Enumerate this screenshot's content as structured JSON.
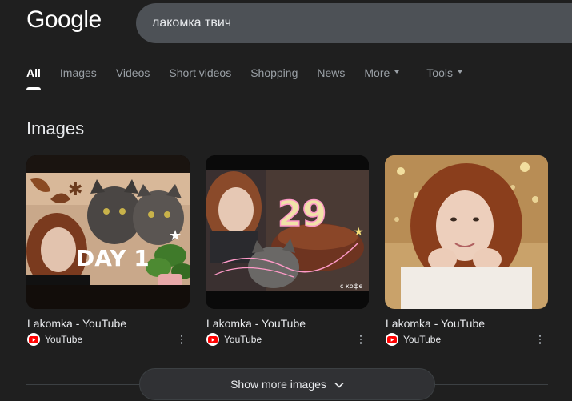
{
  "header": {
    "logo_text": "Google",
    "search_query": "лакомка твич"
  },
  "tabs": [
    {
      "label": "All",
      "active": true
    },
    {
      "label": "Images"
    },
    {
      "label": "Videos"
    },
    {
      "label": "Short videos"
    },
    {
      "label": "Shopping"
    },
    {
      "label": "News"
    },
    {
      "label": "More"
    },
    {
      "label": "Tools"
    }
  ],
  "images_section": {
    "title": "Images",
    "results": [
      {
        "title": "Lakomka - YouTube",
        "source": "YouTube",
        "thumb_text": "DAY 1"
      },
      {
        "title": "Lakomka - YouTube",
        "source": "YouTube",
        "thumb_text": "29",
        "thumb_caption": "с кофе"
      },
      {
        "title": "Lakomka - YouTube",
        "source": "YouTube"
      }
    ],
    "show_more_label": "Show more images"
  },
  "colors": {
    "background": "#1f1f1f",
    "search_box": "#4d5156",
    "youtube_red": "#ff0000"
  }
}
